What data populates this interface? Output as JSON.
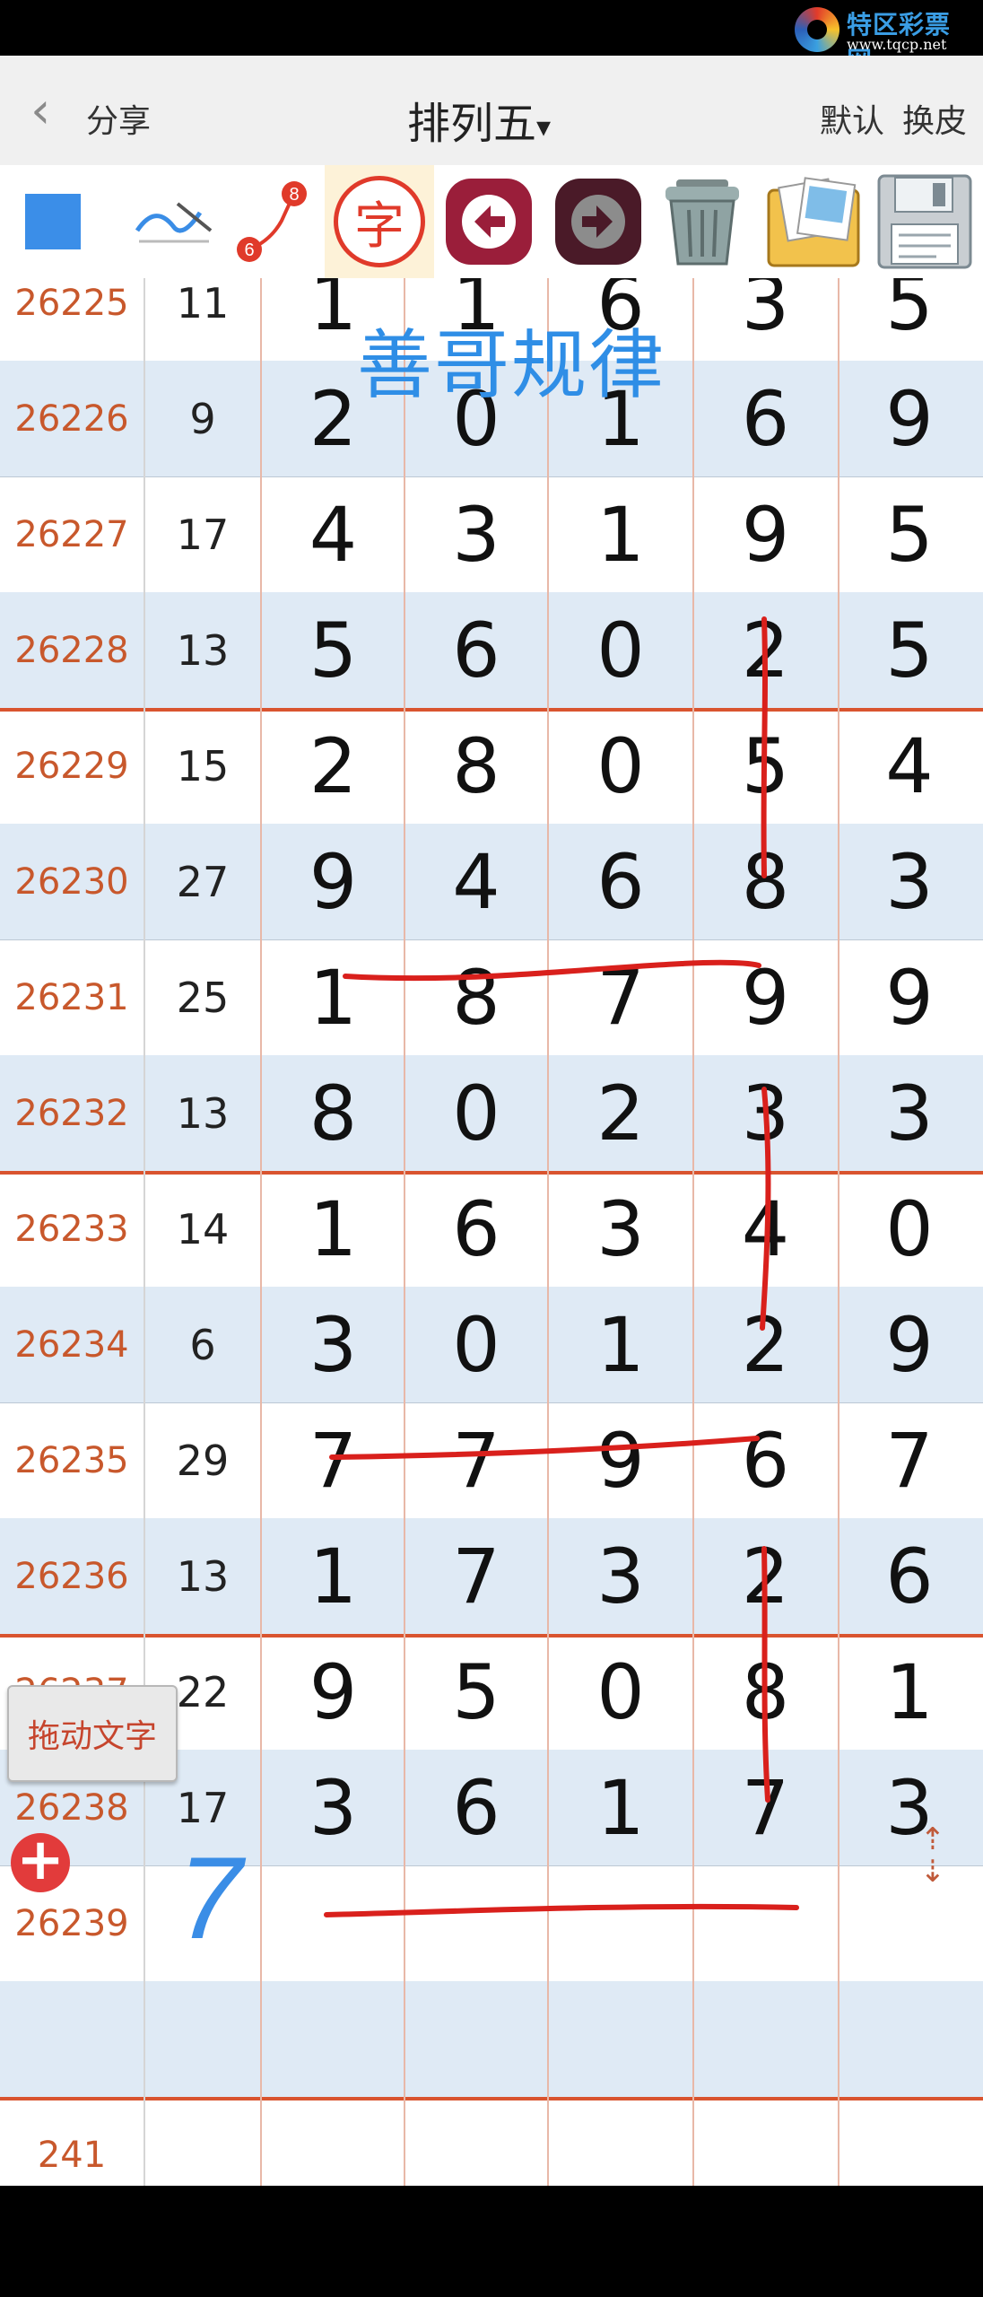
{
  "watermark": {
    "title": "特区彩票网",
    "url": "www.tqcp.net"
  },
  "header": {
    "back_icon": "chevron-left-icon",
    "share": "分享",
    "title": "排列五",
    "title_caret": "▾",
    "default": "默认",
    "skin": "换皮"
  },
  "toolbar": {
    "tools": [
      {
        "icon": "square-fill-icon",
        "color": "#3b8ee8"
      },
      {
        "icon": "pen-line-icon"
      },
      {
        "icon": "step-line-icon",
        "badge_start": "6",
        "badge_end": "8"
      },
      {
        "icon": "text-char-icon",
        "label": "字"
      },
      {
        "icon": "undo-arrow-icon"
      },
      {
        "icon": "redo-arrow-icon"
      },
      {
        "icon": "trash-can-icon"
      },
      {
        "icon": "photo-album-icon"
      },
      {
        "icon": "floppy-save-icon"
      }
    ]
  },
  "table": {
    "overlay_title": "善哥规律",
    "rows": [
      {
        "issue": "26225",
        "sum": "11",
        "digits": [
          "1",
          "1",
          "6",
          "3",
          "5"
        ]
      },
      {
        "issue": "26226",
        "sum": "9",
        "digits": [
          "2",
          "0",
          "1",
          "6",
          "9"
        ]
      },
      {
        "issue": "26227",
        "sum": "17",
        "digits": [
          "4",
          "3",
          "1",
          "9",
          "5"
        ]
      },
      {
        "issue": "26228",
        "sum": "13",
        "digits": [
          "5",
          "6",
          "0",
          "2",
          "5"
        ]
      },
      {
        "issue": "26229",
        "sum": "15",
        "digits": [
          "2",
          "8",
          "0",
          "5",
          "4"
        ]
      },
      {
        "issue": "26230",
        "sum": "27",
        "digits": [
          "9",
          "4",
          "6",
          "8",
          "3"
        ]
      },
      {
        "issue": "26231",
        "sum": "25",
        "digits": [
          "1",
          "8",
          "7",
          "9",
          "9"
        ]
      },
      {
        "issue": "26232",
        "sum": "13",
        "digits": [
          "8",
          "0",
          "2",
          "3",
          "3"
        ]
      },
      {
        "issue": "26233",
        "sum": "14",
        "digits": [
          "1",
          "6",
          "3",
          "4",
          "0"
        ]
      },
      {
        "issue": "26234",
        "sum": "6",
        "digits": [
          "3",
          "0",
          "1",
          "2",
          "9"
        ]
      },
      {
        "issue": "26235",
        "sum": "29",
        "digits": [
          "7",
          "7",
          "9",
          "6",
          "7"
        ]
      },
      {
        "issue": "26236",
        "sum": "13",
        "digits": [
          "1",
          "7",
          "3",
          "2",
          "6"
        ]
      },
      {
        "issue": "26237",
        "sum": "22",
        "digits": [
          "9",
          "5",
          "0",
          "8",
          "1"
        ]
      },
      {
        "issue": "26238",
        "sum": "17",
        "digits": [
          "3",
          "6",
          "1",
          "7",
          "3"
        ]
      },
      {
        "issue": "26239",
        "sum": "",
        "digits": [
          "",
          "",
          "",
          "",
          ""
        ]
      },
      {
        "issue": "",
        "sum": "",
        "digits": [
          "",
          "",
          "",
          "",
          ""
        ]
      },
      {
        "issue": "241",
        "sum": "",
        "digits": [
          "",
          "",
          "",
          "",
          ""
        ]
      }
    ],
    "handwritten_sum": "7",
    "ink_color": "#d9201c",
    "hand_color": "#3a8de6"
  },
  "controls": {
    "drag_text": "拖动文字",
    "add_icon": "plus-circle-icon",
    "updown_icon": "up-down-arrows-icon"
  }
}
